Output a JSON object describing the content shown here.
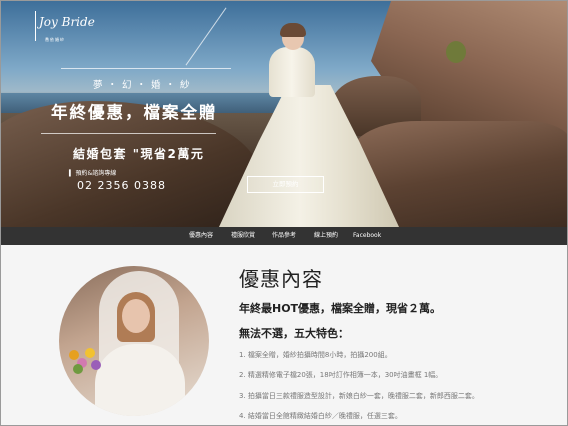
{
  "brand": {
    "logo_name": "Joy Bride",
    "logo_sub": "喬依婚紗"
  },
  "hero": {
    "tagline": "夢・幻・婚・紗",
    "headline": "年終優惠，檔案全贈",
    "package_prefix": "結婚包套",
    "package_highlight": "現省2萬元",
    "contact_label": "預約&諮詢專線",
    "phone": "02 2356 0388",
    "cta_label": "立即預約"
  },
  "nav": {
    "items": [
      "優惠內容",
      "禮服欣賞",
      "作品參考",
      "線上預約",
      "Facebook"
    ]
  },
  "content": {
    "title": "優惠內容",
    "lead": "年終最HOT優惠，檔案全贈，現省２萬。",
    "subtitle": "無法不選，五大特色：",
    "features": [
      "1. 檔案全贈，婚紗拍攝時間8小時，拍攝200組。",
      "2. 精選精修電子檔20張，18吋訂作相簿一本，30吋油畫框 1幅。",
      "3. 拍攝當日三款禮服造型設計，新娘白紗一套，晚禮服二套，新郎西服二套。",
      "4. 結婚當日全館精緻結婚白紗／晚禮服，任選三套。"
    ]
  },
  "colors": {
    "nav_bg": "#333333",
    "text_dark": "#222222",
    "text_muted": "#777777"
  },
  "icons": {
    "logo": "bride-script-logo"
  }
}
